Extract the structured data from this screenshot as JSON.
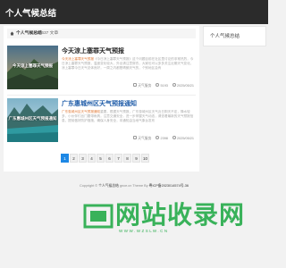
{
  "header": {
    "site_title": "个人气候总结"
  },
  "sidebar": {
    "title": "个人气候总结"
  },
  "breadcrumb": {
    "home": "个人气候总结",
    "separator": "|",
    "count": "39637 文章"
  },
  "articles": [
    {
      "title": "今天涼上塞罪天气预报",
      "thumb_caption": "今天涼上塞罪天气预报",
      "summary_highlight": "今天涼上塞罪天气预报",
      "summary_rest": "《今日涼上塞罪天气预报》这个问题目前在社区里讨论的非常热烈，今日涼上塞罪天气预报，温度变化较大，外出请注意穿衣，大家也可以多多关注近期天气变化，涼上塞罪今日天气总体良好，一周之内都是晴朗天气的，个别地区会有",
      "category": "天气服务",
      "views": "5193",
      "date": "2025/05/21"
    },
    {
      "title": "广东惠城州区天气预报通知",
      "thumb_caption": "广东惠城州区天气预报通知",
      "summary_highlight": "广东惠城州区天气预报通知",
      "summary_rest": "重要，根据天气预报，广东惠城州区天气近日阴天不定，降水较多，小伙伴们出门要带雨具，注意交通安全，进一步掌握天气动态，请查看最新的天气预报信息，提前做好防护措施，确保人身安全，本通知由当地气象台发布",
      "category": "天气服务",
      "views": "2398",
      "date": "2025/05/21"
    }
  ],
  "pagination": {
    "pages": [
      "1",
      "2",
      "3",
      "4",
      "5",
      "6",
      "7",
      "8",
      "9",
      "10"
    ],
    "active": "1"
  },
  "footer": {
    "copyright": "Copyright © ",
    "brand": "个人气候总结",
    "powered": " gnce.cn Theme By ",
    "icp": "粤ICP备2023014574号-36"
  },
  "watermark": {
    "text": "网站收录网",
    "sub": "WWW.WZSLW.CN"
  },
  "colors": {
    "header_bg": "#2b2b2b",
    "accent": "#1e88e5",
    "link_title": "#1e5ba8",
    "highlight": "#e07b39",
    "watermark": "#39b25a"
  }
}
